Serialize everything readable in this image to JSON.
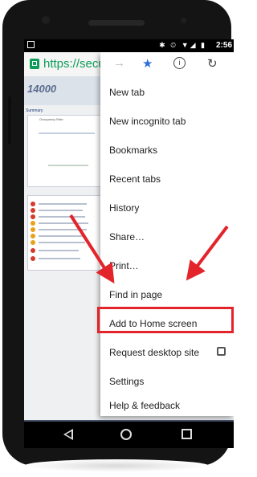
{
  "status_bar": {
    "icons": "✱ ⏲ ▼◢ ▮",
    "time": "2:56"
  },
  "browser": {
    "url": "https://secure"
  },
  "webpage": {
    "logo": "14000",
    "summary_heading": "Summary",
    "occupancy_label": "Occupancy Rate"
  },
  "menu": {
    "top_icons": [
      "forward-icon",
      "bookmark-star-icon",
      "info-icon",
      "reload-icon"
    ],
    "items": [
      {
        "label": "New tab"
      },
      {
        "label": "New incognito tab"
      },
      {
        "label": "Bookmarks"
      },
      {
        "label": "Recent tabs"
      },
      {
        "label": "History"
      },
      {
        "label": "Share…"
      },
      {
        "label": "Print…"
      },
      {
        "label": "Find in page"
      },
      {
        "label": "Add to Home screen"
      },
      {
        "label": "Request desktop site"
      },
      {
        "label": "Settings"
      },
      {
        "label": "Help & feedback"
      }
    ],
    "highlighted_item": "Add to Home screen",
    "request_desktop_checked": false
  },
  "colors": {
    "secure_green": "#0d9d58",
    "highlight_red": "#e3242b",
    "star_blue": "#2f6fd6"
  }
}
